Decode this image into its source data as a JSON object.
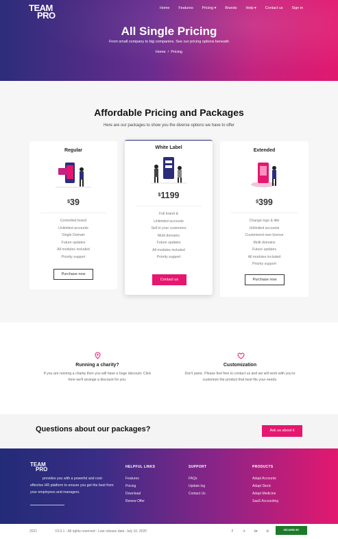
{
  "brand": {
    "line1": "TEAM",
    "line2": "PRO"
  },
  "nav": [
    "Home",
    "Features",
    "Pricing ▾",
    "Brands",
    "Help ▾",
    "Contact us",
    "Sign in"
  ],
  "hero": {
    "title": "All Single Pricing",
    "subtitle": "From small company to big companies. See our pricing options beneath",
    "breadcrumb_home": "Home",
    "breadcrumb_sep": "/",
    "breadcrumb_current": "Pricing"
  },
  "pricing": {
    "title": "Affordable Pricing and Packages",
    "subtitle": "Here are our packages to show you the diverse options we have to offer",
    "plans": [
      {
        "name": "Regular",
        "currency": "$",
        "amount": "39",
        "features": [
          "Controlled brand",
          "Unlimited accounts",
          "Single Domain",
          "Future updates",
          "All modules included",
          "Priority support"
        ],
        "button": "Purchase now"
      },
      {
        "name": "White Label",
        "currency": "$",
        "amount": "1199",
        "features": [
          "Full brand &",
          "Unlimited accounts",
          "Sell to your customers",
          "Multi domains",
          "Future updates",
          "All modules included",
          "Priority support"
        ],
        "button": "Contact us"
      },
      {
        "name": "Extended",
        "currency": "$",
        "amount": "399",
        "features": [
          "Change logo & title",
          "Unlimited accounts",
          "Customized own license",
          "Multi domains",
          "Future updates",
          "All modules included",
          "Priority support"
        ],
        "button": "Purchase now"
      }
    ]
  },
  "features": [
    {
      "title": "Running a charity?",
      "text_line1": "If you are running a charity then you will have a huge discount. Click",
      "text_line2": "here we'll arrange a discount for you."
    },
    {
      "title": "Customization",
      "text_line1": "Don't panic. Please feel free to contact us and we will work with you to",
      "text_line2": "customize the product that best fits your needs."
    }
  ],
  "questions": {
    "text": "Questions about our packages?",
    "button": "Ask us about it"
  },
  "footer": {
    "about_line1": "provides you with a powerful and cost-",
    "about_line2": "effective HR platform to ensure you get the best from",
    "about_line3": "your employees and managers.",
    "columns": [
      {
        "title": "HELPFUL LINKS",
        "links": [
          "Features",
          "Pricing",
          "Download",
          "Renew Offer"
        ]
      },
      {
        "title": "SUPPORT",
        "links": [
          "FAQs",
          "Update log",
          "Contact Us"
        ]
      },
      {
        "title": "PRODUCTS",
        "links": [
          "Adapt Accounts",
          "Adapt Stock",
          "Adapt Medicine",
          "SaaS Accounting"
        ]
      }
    ]
  },
  "bottom": {
    "year": "2021",
    "copyright": "V3.0.1 - All rights reserved - Last release date: July 10, 2020",
    "badge": "SECURED BY POSITIVESSL",
    "social_icons": [
      "facebook-icon",
      "twitter-icon",
      "linkedin-icon",
      "dribbble-icon"
    ]
  },
  "colors": {
    "accent": "#e5176f",
    "navy": "#2c2d7a"
  }
}
